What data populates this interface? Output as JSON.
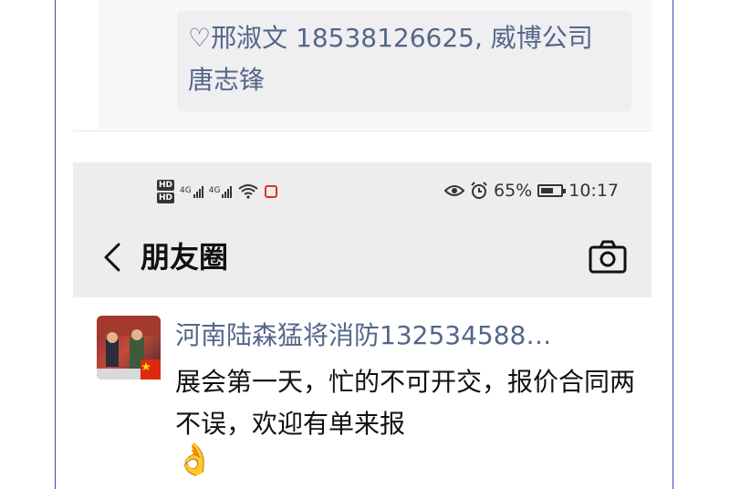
{
  "comment": {
    "line1": "♡邢淑文 18538126625, 威博公司",
    "line2": "唐志锋"
  },
  "status_bar": {
    "hd1": "HD",
    "hd2": "HD",
    "net1": "4G",
    "net2": "4G",
    "battery_pct": "65%",
    "battery_level": 0.65,
    "time": "10:17"
  },
  "nav": {
    "title": "朋友圈"
  },
  "post": {
    "name": "河南陆森猛将消防132534588…",
    "text": "展会第一天，忙的不可开交，报价合同两不误，欢迎有单来报",
    "emoji": "👌"
  },
  "colors": {
    "link": "#55668a",
    "bar_bg": "#ededed",
    "frame": "#3b4bbf"
  }
}
